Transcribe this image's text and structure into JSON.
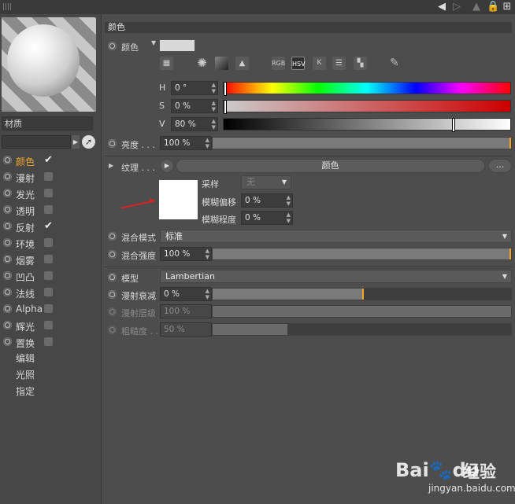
{
  "left": {
    "material_label": "材质",
    "channels": [
      {
        "label": "颜色",
        "active": true,
        "checked": true
      },
      {
        "label": "漫射",
        "active": false,
        "checked": false
      },
      {
        "label": "发光",
        "active": false,
        "checked": false
      },
      {
        "label": "透明",
        "active": false,
        "checked": false
      },
      {
        "label": "反射",
        "active": false,
        "checked": true
      },
      {
        "label": "环境",
        "active": false,
        "checked": false
      },
      {
        "label": "烟雾",
        "active": false,
        "checked": false
      },
      {
        "label": "凹凸",
        "active": false,
        "checked": false
      },
      {
        "label": "法线",
        "active": false,
        "checked": false
      },
      {
        "label": "Alpha",
        "active": false,
        "checked": false
      },
      {
        "label": "辉光",
        "active": false,
        "checked": false
      },
      {
        "label": "置换",
        "active": false,
        "checked": false
      }
    ],
    "extras": [
      "编辑",
      "光照",
      "指定"
    ]
  },
  "section_title": "颜色",
  "color": {
    "label": "颜色",
    "swatch": "#d8d8d8",
    "mode_icons": [
      "RGB",
      "HSV",
      "K"
    ],
    "h_label": "H",
    "h_value": "0 °",
    "s_label": "S",
    "s_value": "0 %",
    "v_label": "V",
    "v_value": "80 %",
    "v_fraction": 0.8
  },
  "brightness": {
    "label": "亮度 . . .",
    "value": "100 %"
  },
  "texture": {
    "label": "纹理 . . .",
    "button": "颜色",
    "more": "...",
    "sampling_label": "采样",
    "sampling_value": "无",
    "blur_offset_label": "模糊偏移",
    "blur_offset_value": "0 %",
    "blur_degree_label": "模糊程度",
    "blur_degree_value": "0 %"
  },
  "mix_mode": {
    "label": "混合模式",
    "value": "标准"
  },
  "mix_strength": {
    "label": "混合强度",
    "value": "100 %"
  },
  "model": {
    "label": "模型",
    "value": "Lambertian"
  },
  "diffuse_falloff": {
    "label": "漫射衰减",
    "value": "0 %"
  },
  "diffuse_level": {
    "label": "漫射层级",
    "value": "100 %"
  },
  "roughness": {
    "label": "粗糙度 . .",
    "value": "50 %"
  },
  "watermark": {
    "logo": "Bai",
    "logo2": "du",
    "cn": "经验",
    "url": "jingyan.baidu.com"
  }
}
